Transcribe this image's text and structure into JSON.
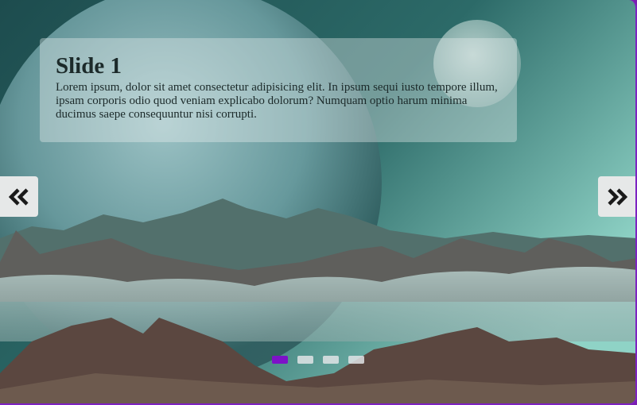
{
  "slider": {
    "slides": [
      {
        "title": "Slide 1",
        "text": "Lorem ipsum, dolor sit amet consectetur adipisicing elit. In ipsum sequi iusto tempore illum, ipsam corporis odio quod veniam explicabo dolorum? Numquam optio harum minima ducimus saepe consequuntur nisi corrupti."
      }
    ],
    "active_index": 0,
    "dot_count": 4,
    "prev_icon": "double-chevron-left-icon",
    "next_icon": "double-chevron-right-icon",
    "colors": {
      "accent": "#7d12c8",
      "border": "#7d22c2",
      "arrow_bg": "#e6e8e8",
      "dot_inactive": "#e1e4e6"
    }
  }
}
